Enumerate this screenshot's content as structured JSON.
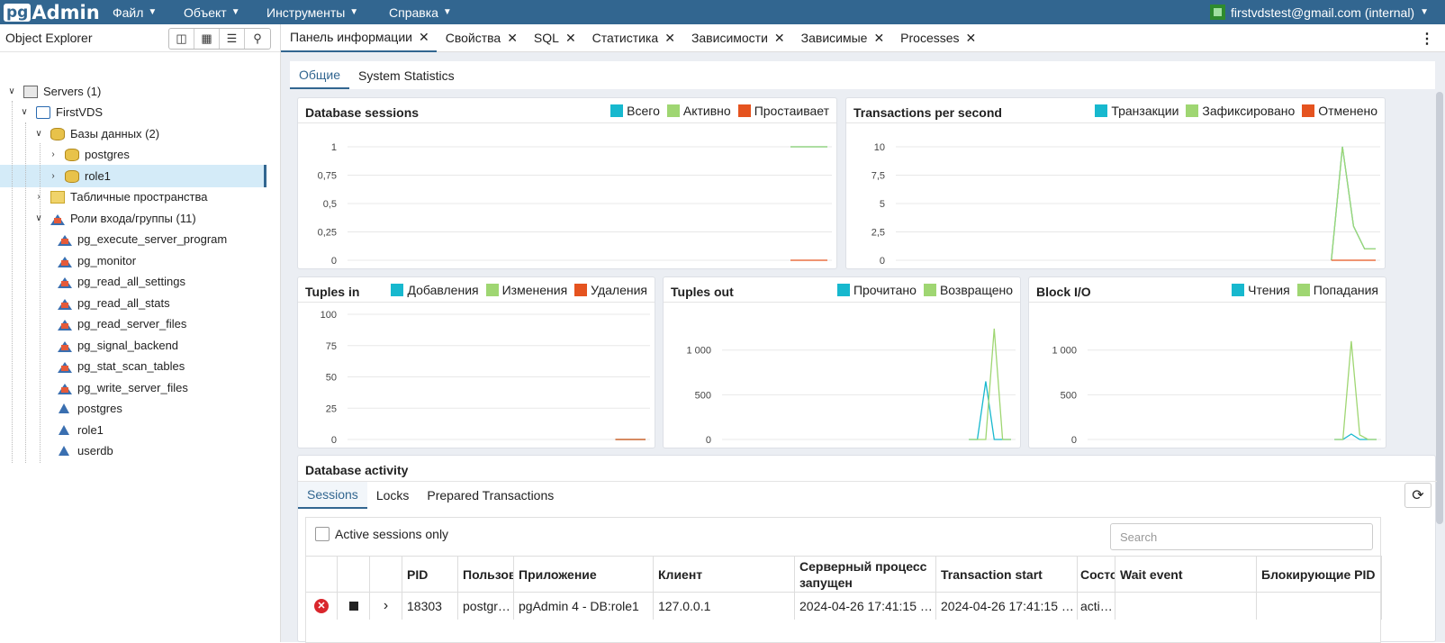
{
  "app": {
    "logo_pg": "pg",
    "logo_admin": "Admin",
    "menus": [
      "Файл",
      "Объект",
      "Инструменты",
      "Справка"
    ],
    "user": "firstvdstest@gmail.com (internal)"
  },
  "explorer": {
    "title": "Object Explorer",
    "tree": {
      "servers": "Servers (1)",
      "server": "FirstVDS",
      "databases": "Базы данных (2)",
      "db1": "postgres",
      "db2": "role1",
      "tablespaces": "Табличные пространства",
      "roles": "Роли входа/группы (11)",
      "role_items": [
        "pg_execute_server_program",
        "pg_monitor",
        "pg_read_all_settings",
        "pg_read_all_stats",
        "pg_read_server_files",
        "pg_signal_backend",
        "pg_stat_scan_tables",
        "pg_write_server_files",
        "postgres",
        "role1",
        "userdb"
      ]
    }
  },
  "tabs": [
    "Панель информации",
    "Свойства",
    "SQL",
    "Статистика",
    "Зависимости",
    "Зависимые",
    "Processes"
  ],
  "subtabs": [
    "Общие",
    "System Statistics"
  ],
  "colors": {
    "teal": "#17b8ce",
    "green": "#9fd672",
    "orange": "#e5531f",
    "blue": "#326690"
  },
  "panels": {
    "sessions": {
      "title": "Database sessions",
      "legend": [
        "Всего",
        "Активно",
        "Простаивает"
      ]
    },
    "tps": {
      "title": "Transactions per second",
      "legend": [
        "Транзакции",
        "Зафиксировано",
        "Отменено"
      ]
    },
    "tin": {
      "title": "Tuples in",
      "legend": [
        "Добавления",
        "Изменения",
        "Удаления"
      ]
    },
    "tout": {
      "title": "Tuples out",
      "legend": [
        "Прочитано",
        "Возвращено"
      ]
    },
    "bio": {
      "title": "Block I/O",
      "legend": [
        "Чтения",
        "Попадания"
      ]
    }
  },
  "chart_data": [
    {
      "type": "line",
      "title": "Database sessions",
      "yticks": [
        "1",
        "0,75",
        "0,5",
        "0,25",
        "0"
      ],
      "ylim": [
        0,
        1
      ],
      "series": [
        {
          "name": "Всего",
          "values": [
            1,
            1,
            1,
            1,
            1,
            1,
            1
          ]
        },
        {
          "name": "Активно",
          "values": [
            1,
            1,
            1,
            1,
            1,
            1,
            1
          ]
        },
        {
          "name": "Простаивает",
          "values": [
            0,
            0,
            0,
            0,
            0,
            0,
            0
          ]
        }
      ]
    },
    {
      "type": "line",
      "title": "Transactions per second",
      "yticks": [
        "10",
        "7,5",
        "5",
        "2,5",
        "0"
      ],
      "ylim": [
        0,
        10
      ],
      "series": [
        {
          "name": "Транзакции",
          "values": [
            0,
            10,
            3,
            1,
            1
          ]
        },
        {
          "name": "Зафиксировано",
          "values": [
            0,
            10,
            3,
            1,
            1
          ]
        },
        {
          "name": "Отменено",
          "values": [
            0,
            0,
            0,
            0,
            0
          ]
        }
      ]
    },
    {
      "type": "line",
      "title": "Tuples in",
      "yticks": [
        "100",
        "75",
        "50",
        "25",
        "0"
      ],
      "ylim": [
        0,
        100
      ],
      "series": [
        {
          "name": "Добавления",
          "values": [
            0,
            0,
            0,
            0,
            0
          ]
        },
        {
          "name": "Изменения",
          "values": [
            0,
            0,
            0,
            0,
            0
          ]
        },
        {
          "name": "Удаления",
          "values": [
            0,
            0,
            0,
            0,
            0
          ]
        }
      ]
    },
    {
      "type": "line",
      "title": "Tuples out",
      "yticks": [
        "1 000",
        "500",
        "0"
      ],
      "ylim": [
        0,
        1400
      ],
      "series": [
        {
          "name": "Прочитано",
          "values": [
            0,
            0,
            650,
            0,
            0,
            0
          ]
        },
        {
          "name": "Возвращено",
          "values": [
            0,
            0,
            0,
            1240,
            0,
            0
          ]
        }
      ]
    },
    {
      "type": "line",
      "title": "Block I/O",
      "yticks": [
        "1 000",
        "500",
        "0"
      ],
      "ylim": [
        0,
        1400
      ],
      "series": [
        {
          "name": "Чтения",
          "values": [
            0,
            0,
            60,
            0,
            0,
            0
          ]
        },
        {
          "name": "Попадания",
          "values": [
            0,
            0,
            1100,
            50,
            0,
            0
          ]
        }
      ]
    }
  ],
  "activity": {
    "title": "Database activity",
    "tabs": [
      "Sessions",
      "Locks",
      "Prepared Transactions"
    ],
    "active_only": "Active sessions only",
    "search_placeholder": "Search",
    "headers": [
      "PID",
      "Пользов",
      "Приложение",
      "Клиент",
      "Серверный процесс запущен",
      "Transaction start",
      "Состо",
      "Wait event",
      "Блокирующие PID"
    ],
    "row": [
      "18303",
      "postgr…",
      "pgAdmin 4 - DB:role1",
      "127.0.0.1",
      "2024-04-26 17:41:15 …",
      "2024-04-26 17:41:15 …",
      "acti…",
      "",
      ""
    ]
  }
}
